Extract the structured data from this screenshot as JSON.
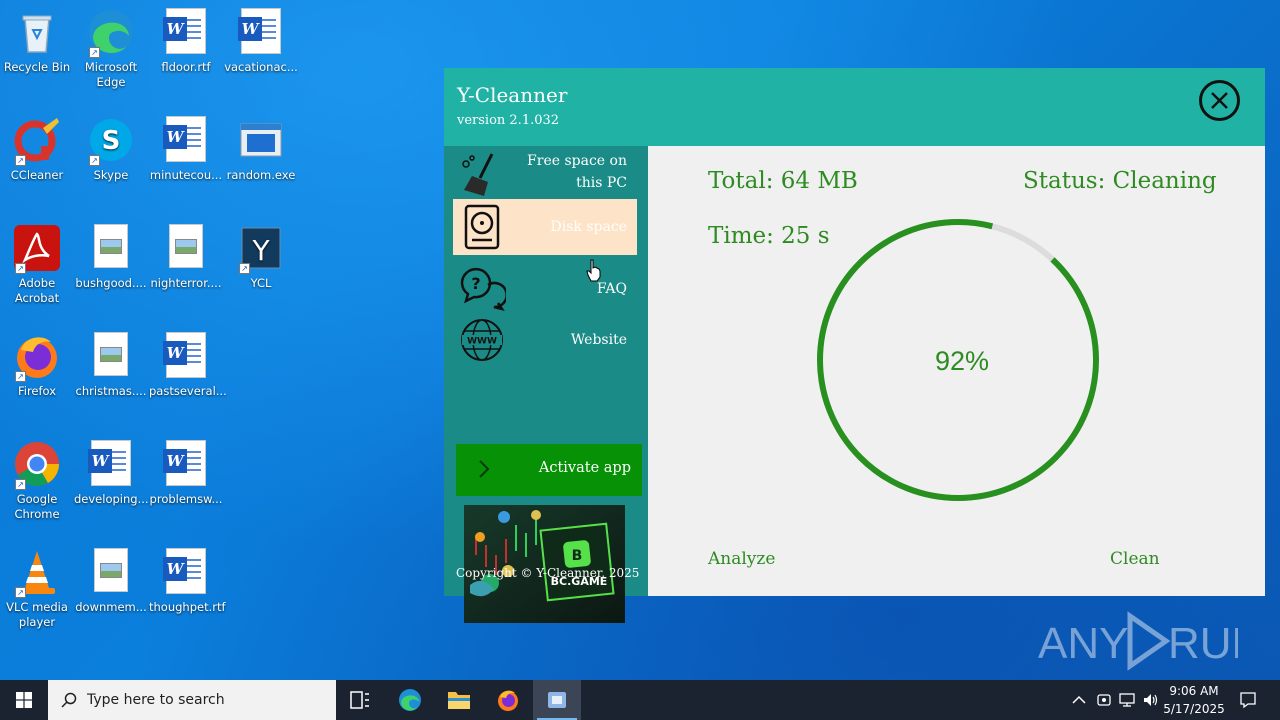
{
  "desktop": {
    "icons": [
      {
        "label": "Recycle Bin"
      },
      {
        "label": "Microsoft Edge"
      },
      {
        "label": "fldoor.rtf"
      },
      {
        "label": "vacationac..."
      },
      {
        "label": "CCleaner"
      },
      {
        "label": "Skype"
      },
      {
        "label": "minutecou..."
      },
      {
        "label": "random.exe"
      },
      {
        "label": "Adobe Acrobat"
      },
      {
        "label": "bushgood...."
      },
      {
        "label": "nighterror...."
      },
      {
        "label": "YCL"
      },
      {
        "label": "Firefox"
      },
      {
        "label": "christmas...."
      },
      {
        "label": "pastseveral..."
      },
      {
        "label": "Google Chrome"
      },
      {
        "label": "developing..."
      },
      {
        "label": "problemsw..."
      },
      {
        "label": "VLC media player"
      },
      {
        "label": "downmem..."
      },
      {
        "label": "thoughpet.rtf"
      }
    ]
  },
  "app": {
    "title": "Y-Cleanner",
    "version": "version 2.1.032",
    "sidebar": {
      "items": [
        {
          "label_line1": "Free space on",
          "label_line2": "this PC",
          "icon": "broom-icon"
        },
        {
          "label": "Disk space",
          "icon": "hard-drive-icon",
          "active": true
        },
        {
          "label": "FAQ",
          "icon": "question-bubbles-icon"
        },
        {
          "label": "Website",
          "icon": "www-globe-icon"
        }
      ],
      "activate_label": "Activate app",
      "ad_text": "BC.GAME",
      "copyright": "Copyright © Y-Cleanner, 2025"
    },
    "main": {
      "total": "Total: 64 MB",
      "status": "Status: Cleaning",
      "time": "Time: 25 s",
      "progress_percent": 92,
      "progress_label": "92%",
      "analyze_label": "Analyze",
      "clean_label": "Clean"
    },
    "colors": {
      "header": "#20b2a5",
      "sidebar": "#1a8b87",
      "accent_green": "#2e8b22",
      "activate_bg": "#079107",
      "active_item_bg": "#fde3c8"
    }
  },
  "taskbar": {
    "search_placeholder": "Type here to search",
    "time": "9:06 AM",
    "date": "5/17/2025"
  },
  "watermark": {
    "text_left": "ANY",
    "text_right": "RUN"
  }
}
